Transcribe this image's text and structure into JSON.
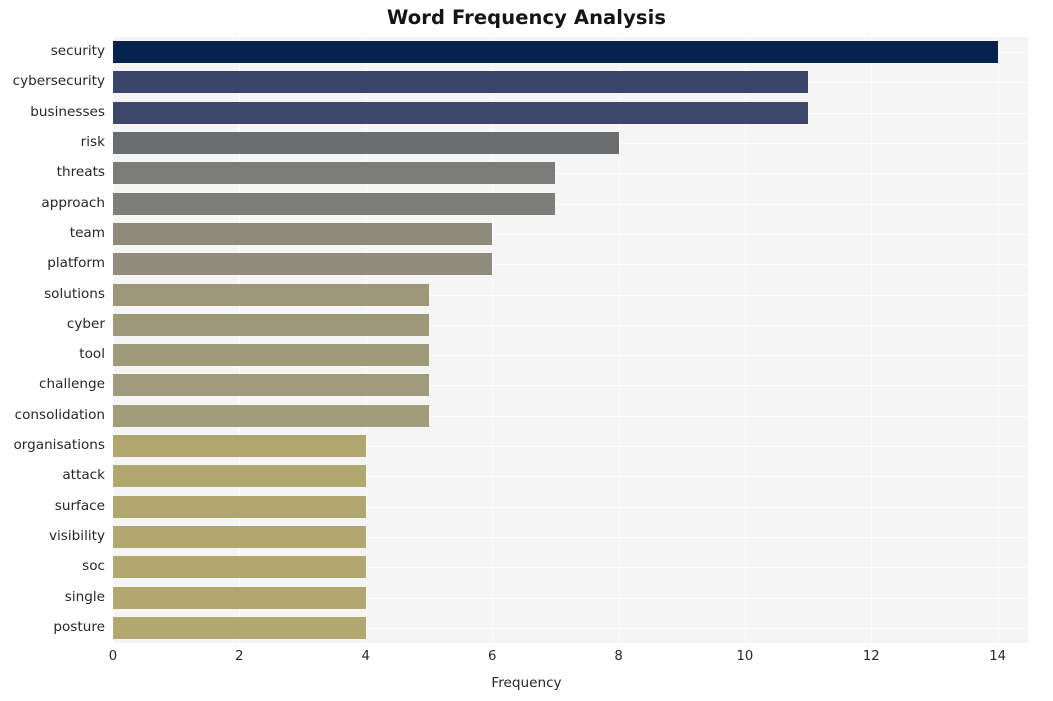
{
  "chart_data": {
    "type": "bar",
    "orientation": "horizontal",
    "title": "Word Frequency Analysis",
    "xlabel": "Frequency",
    "ylabel": "",
    "xlim": [
      0,
      14.48
    ],
    "xticks": [
      0,
      2,
      4,
      6,
      8,
      10,
      12,
      14
    ],
    "xtick_labels": [
      "0",
      "2",
      "4",
      "6",
      "8",
      "10",
      "12",
      "14"
    ],
    "grid": true,
    "grid_color": "#fdfdfd",
    "plot_background": "#f5f5f6",
    "figure_background": "#ffffff",
    "legend": null,
    "categories": [
      "security",
      "cybersecurity",
      "businesses",
      "risk",
      "threats",
      "approach",
      "team",
      "platform",
      "solutions",
      "cyber",
      "tool",
      "challenge",
      "consolidation",
      "organisations",
      "attack",
      "surface",
      "visibility",
      "soc",
      "single",
      "posture"
    ],
    "values": [
      14,
      11,
      11,
      8,
      7,
      7,
      6,
      6,
      5,
      5,
      5,
      5,
      5,
      4,
      4,
      4,
      4,
      4,
      4,
      4
    ],
    "bar_colors": [
      "#04224c",
      "#3a4569",
      "#3c476a",
      "#6a6c70",
      "#7b7b79",
      "#7d7d7b",
      "#8d8a7c",
      "#908c7e",
      "#9d9878",
      "#9e9979",
      "#9f9a79",
      "#a09b7a",
      "#a19c7a",
      "#b0a770",
      "#b0a770",
      "#b0a770",
      "#b1a871",
      "#b1a871",
      "#b1a871",
      "#b1a871"
    ]
  }
}
